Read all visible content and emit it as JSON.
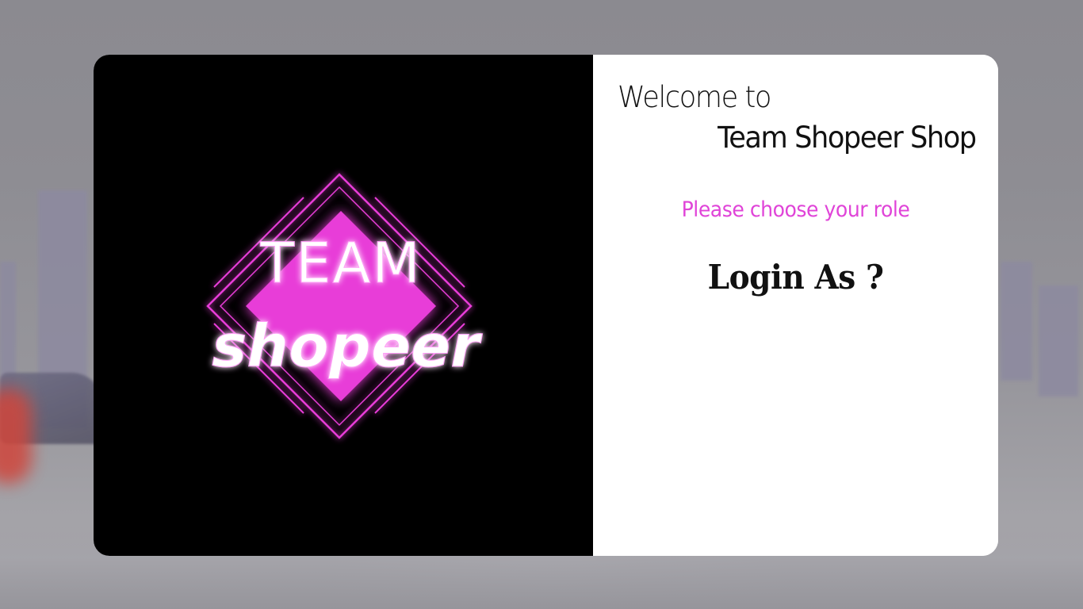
{
  "welcome": {
    "line1": "Welcome to",
    "line2": "Team Shopeer Shop"
  },
  "prompt": "Please choose your role",
  "heading": "Login As ?",
  "logo": {
    "text_top": "TEAM",
    "text_bottom": "shopeer",
    "accent": "#e83cd8",
    "glow": "#ff4df5"
  },
  "colors": {
    "prompt": "#e044d8",
    "panel_left": "#000000",
    "panel_right": "#ffffff"
  }
}
